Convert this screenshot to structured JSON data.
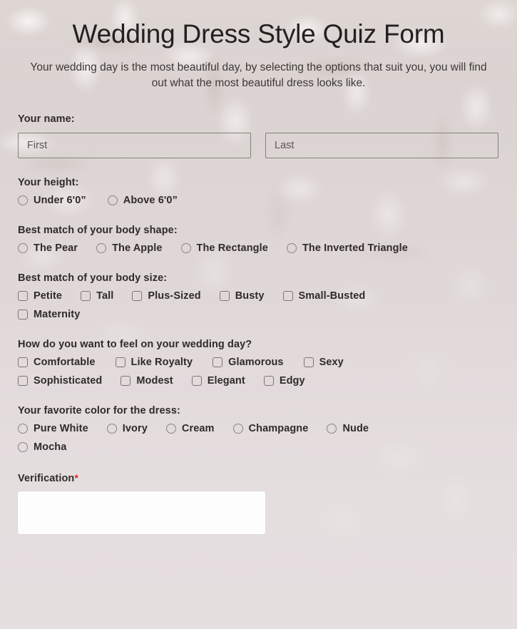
{
  "header": {
    "title": "Wedding Dress Style Quiz Form",
    "subtitle": "Your wedding day is the most beautiful day, by selecting the options that suit you, you will find out what the most beautiful dress looks like."
  },
  "name_question": {
    "label": "Your name:",
    "first_placeholder": "First",
    "first_value": "",
    "last_placeholder": "Last",
    "last_value": ""
  },
  "height_question": {
    "label": "Your height:",
    "type": "radio",
    "options": [
      {
        "label": "Under 6'0”"
      },
      {
        "label": "Above 6'0”"
      }
    ]
  },
  "body_shape_question": {
    "label": "Best match of your body shape:",
    "type": "radio",
    "options": [
      {
        "label": "The Pear"
      },
      {
        "label": "The Apple"
      },
      {
        "label": "The Rectangle"
      },
      {
        "label": "The Inverted Triangle"
      }
    ]
  },
  "body_size_question": {
    "label": "Best match of your body size:",
    "type": "checkbox",
    "rows": [
      [
        {
          "label": "Petite"
        },
        {
          "label": "Tall"
        },
        {
          "label": "Plus-Sized"
        },
        {
          "label": "Busty"
        },
        {
          "label": "Small-Busted"
        }
      ],
      [
        {
          "label": "Maternity"
        }
      ]
    ]
  },
  "feel_question": {
    "label": "How do you want to feel on your wedding day?",
    "type": "checkbox",
    "rows": [
      [
        {
          "label": "Comfortable"
        },
        {
          "label": "Like Royalty"
        },
        {
          "label": "Glamorous"
        },
        {
          "label": "Sexy"
        }
      ],
      [
        {
          "label": "Sophisticated"
        },
        {
          "label": "Modest"
        },
        {
          "label": "Elegant"
        },
        {
          "label": "Edgy"
        }
      ]
    ]
  },
  "color_question": {
    "label": "Your favorite color for the dress:",
    "type": "radio",
    "rows": [
      [
        {
          "label": "Pure White"
        },
        {
          "label": "Ivory"
        },
        {
          "label": "Cream"
        },
        {
          "label": "Champagne"
        },
        {
          "label": "Nude"
        }
      ],
      [
        {
          "label": "Mocha"
        }
      ]
    ]
  },
  "verification": {
    "label": "Verification",
    "required_marker": "*"
  },
  "colors": {
    "page_background": "#ded6d4",
    "title_text": "#242021",
    "label_text": "#2f2b2a",
    "input_border": "#7f8478",
    "required_star": "#e02b2b",
    "captcha_background": "#fdfdfd"
  }
}
